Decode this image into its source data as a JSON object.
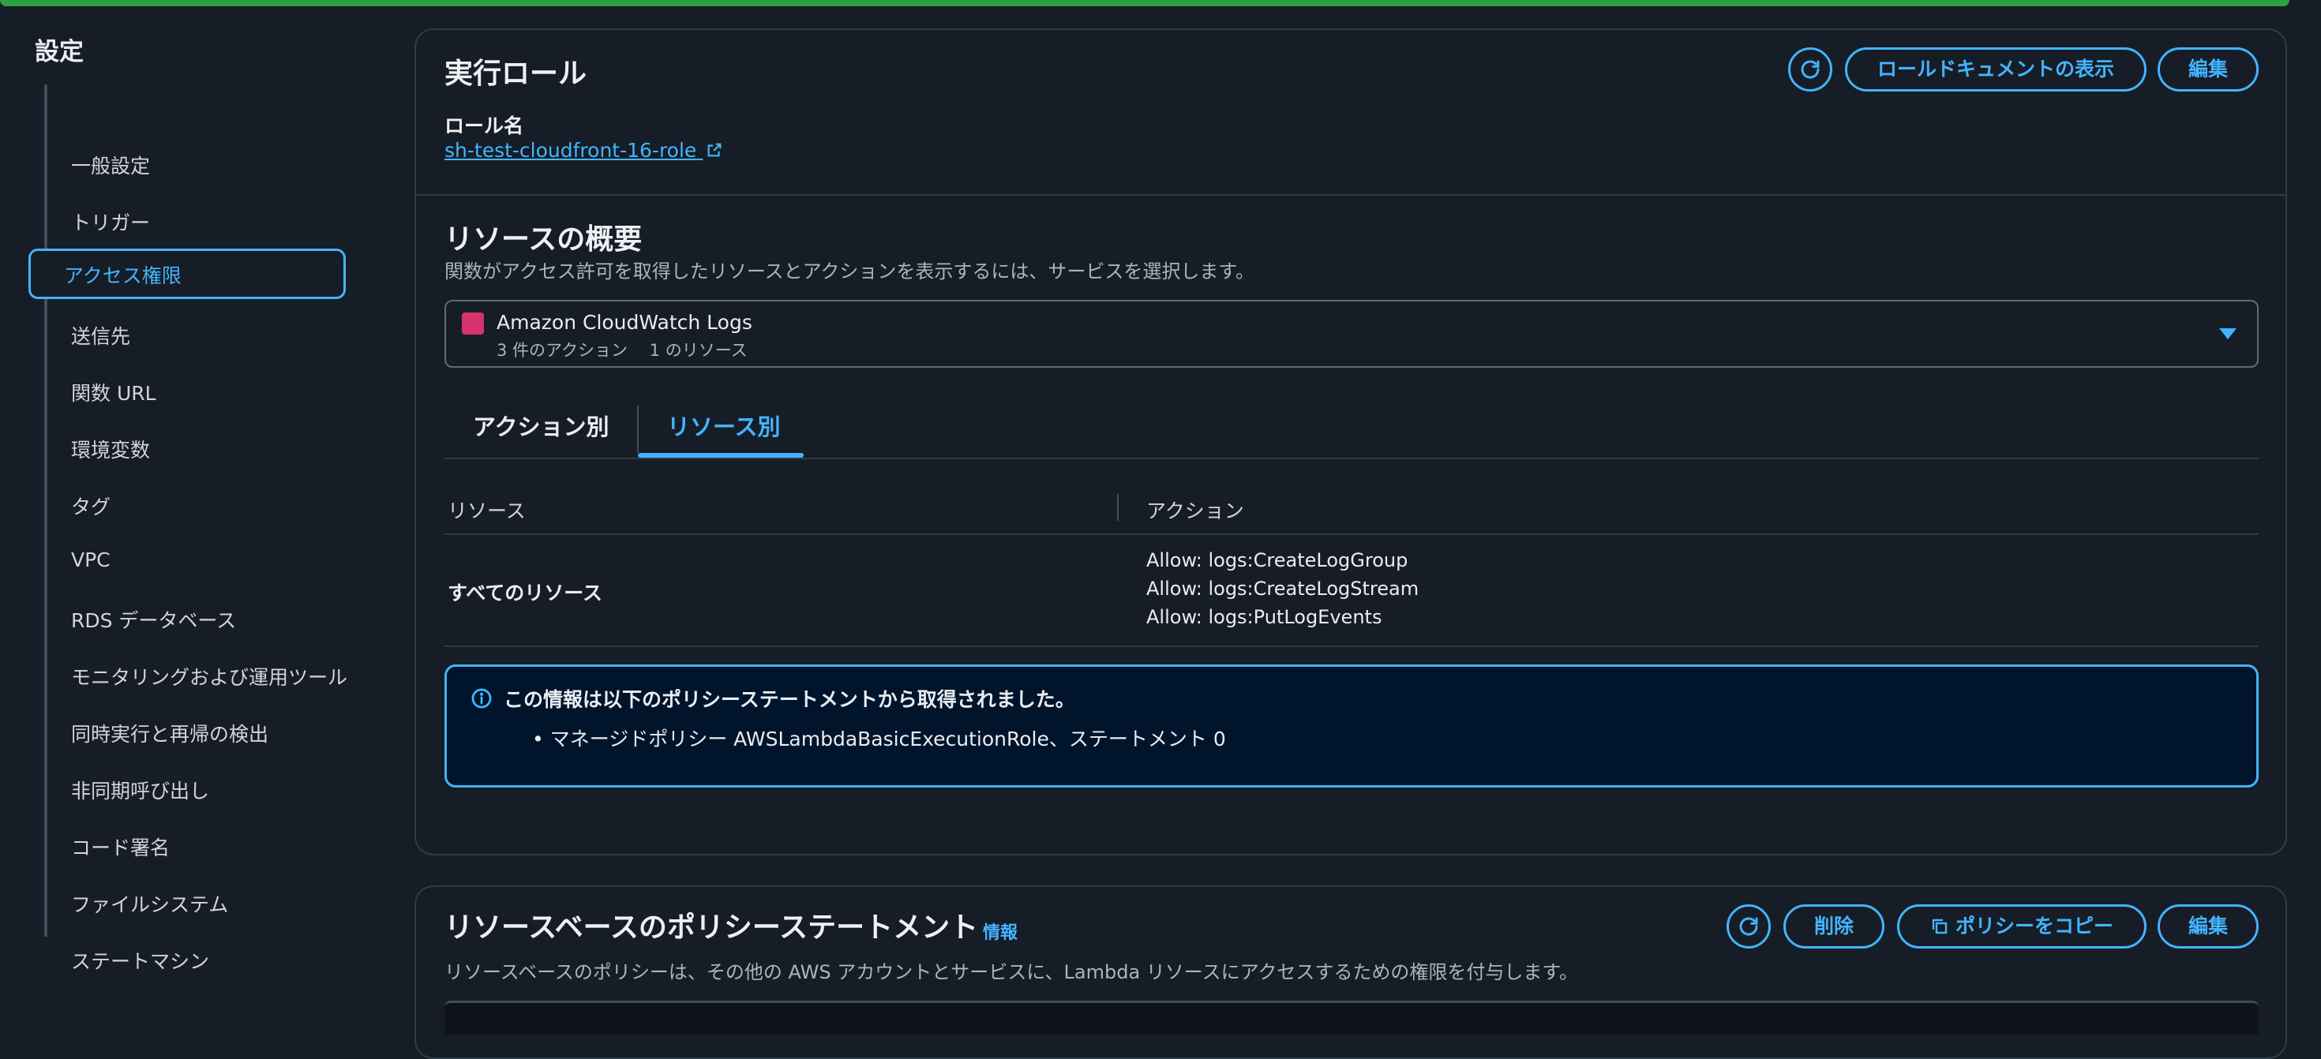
{
  "sidebar": {
    "title": "設定",
    "items": [
      {
        "label": "一般設定"
      },
      {
        "label": "トリガー"
      },
      {
        "label": "アクセス権限"
      },
      {
        "label": "送信先"
      },
      {
        "label": "関数 URL"
      },
      {
        "label": "環境変数"
      },
      {
        "label": "タグ"
      },
      {
        "label": "VPC"
      },
      {
        "label": "RDS データベース"
      },
      {
        "label": "モニタリングおよび運用ツール"
      },
      {
        "label": "同時実行と再帰の検出"
      },
      {
        "label": "非同期呼び出し"
      },
      {
        "label": "コード署名"
      },
      {
        "label": "ファイルシステム"
      },
      {
        "label": "ステートマシン"
      }
    ],
    "active_index": 2
  },
  "execution_role": {
    "title": "実行ロール",
    "buttons": {
      "view_role_document": "ロールドキュメントの表示",
      "edit": "編集"
    },
    "role_name_label": "ロール名",
    "role_name": "sh-test-cloudfront-16-role"
  },
  "resource_summary": {
    "title": "リソースの概要",
    "description": "関数がアクセス許可を取得したリソースとアクションを表示するには、サービスを選択します。",
    "selected_service": {
      "name": "Amazon CloudWatch Logs",
      "meta": "3 件のアクション　 1 のリソース"
    },
    "tabs": [
      {
        "label": "アクション別"
      },
      {
        "label": "リソース別"
      }
    ],
    "active_tab": 1,
    "table": {
      "headers": [
        "リソース",
        "アクション"
      ],
      "rows": [
        {
          "resource": "すべてのリソース",
          "actions": [
            "Allow: logs:CreateLogGroup",
            "Allow: logs:CreateLogStream",
            "Allow: logs:PutLogEvents"
          ]
        }
      ]
    },
    "alert": {
      "title": "この情報は以下のポリシーステートメントから取得されました。",
      "bullets": [
        "マネージドポリシー AWSLambdaBasicExecutionRole、ステートメント 0"
      ]
    }
  },
  "resource_policy": {
    "title": "リソースベースのポリシーステートメント",
    "info_link": "情報",
    "description": "リソースベースのポリシーは、その他の AWS アカウントとサービスに、Lambda リソースにアクセスするための権限を付与します。",
    "buttons": {
      "delete": "削除",
      "copy_policy": "ポリシーをコピー",
      "edit": "編集"
    }
  },
  "colors": {
    "background": "#161d26",
    "accent": "#42b4ff",
    "success_bar": "#2ea043",
    "alert_bg": "#00142b",
    "cloudwatch_icon": "#d6336c"
  }
}
